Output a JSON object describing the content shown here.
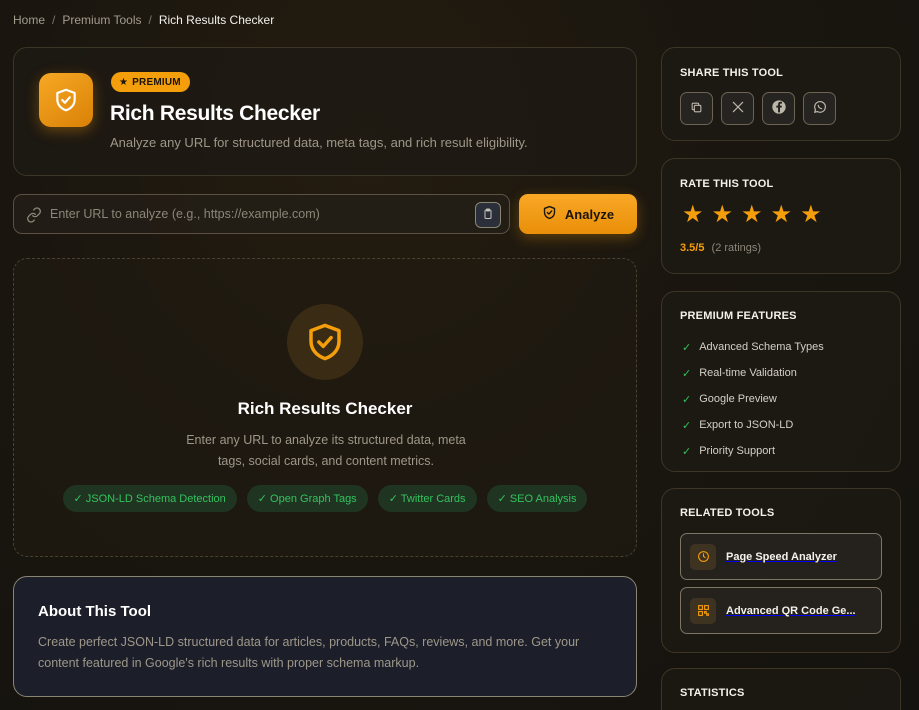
{
  "breadcrumb": {
    "home": "Home",
    "section": "Premium Tools",
    "current": "Rich Results Checker",
    "separator": "/"
  },
  "header": {
    "badge": "PREMIUM",
    "title": "Rich Results Checker",
    "subtitle": "Analyze any URL for structured data, meta tags, and rich result eligibility."
  },
  "url": {
    "placeholder": "Enter URL to analyze (e.g., https://example.com)",
    "value": "",
    "analyze_label": "Analyze"
  },
  "empty": {
    "title": "Rich Results Checker",
    "description": "Enter any URL to analyze its structured data, meta tags, social cards, and content metrics.",
    "chips": [
      "✓ JSON-LD Schema Detection",
      "✓ Open Graph Tags",
      "✓ Twitter Cards",
      "✓ SEO Analysis"
    ]
  },
  "about": {
    "title": "About This Tool",
    "description": "Create perfect JSON-LD structured data for articles, products, FAQs, reviews, and more. Get your content featured in Google's rich results with proper schema markup."
  },
  "sidebar": {
    "share": {
      "title": "SHARE THIS TOOL",
      "buttons": [
        "copy-icon",
        "x-icon",
        "facebook-icon",
        "whatsapp-icon"
      ]
    },
    "rate": {
      "title": "RATE THIS TOOL",
      "stars": 5,
      "score": "3.5/5",
      "count": "(2 ratings)"
    },
    "features": {
      "title": "PREMIUM FEATURES",
      "items": [
        "Advanced Schema Types",
        "Real-time Validation",
        "Google Preview",
        "Export to JSON-LD",
        "Priority Support"
      ]
    },
    "related": {
      "title": "RELATED TOOLS",
      "items": [
        {
          "label": "Page Speed Analyzer",
          "icon": "clock-icon"
        },
        {
          "label": "Advanced QR Code Ge...",
          "icon": "qr-code-icon"
        }
      ]
    },
    "stats": {
      "title": "STATISTICS"
    }
  },
  "colors": {
    "accent": "#f59e0b",
    "success": "#34c15e",
    "background": "#1a160f"
  }
}
